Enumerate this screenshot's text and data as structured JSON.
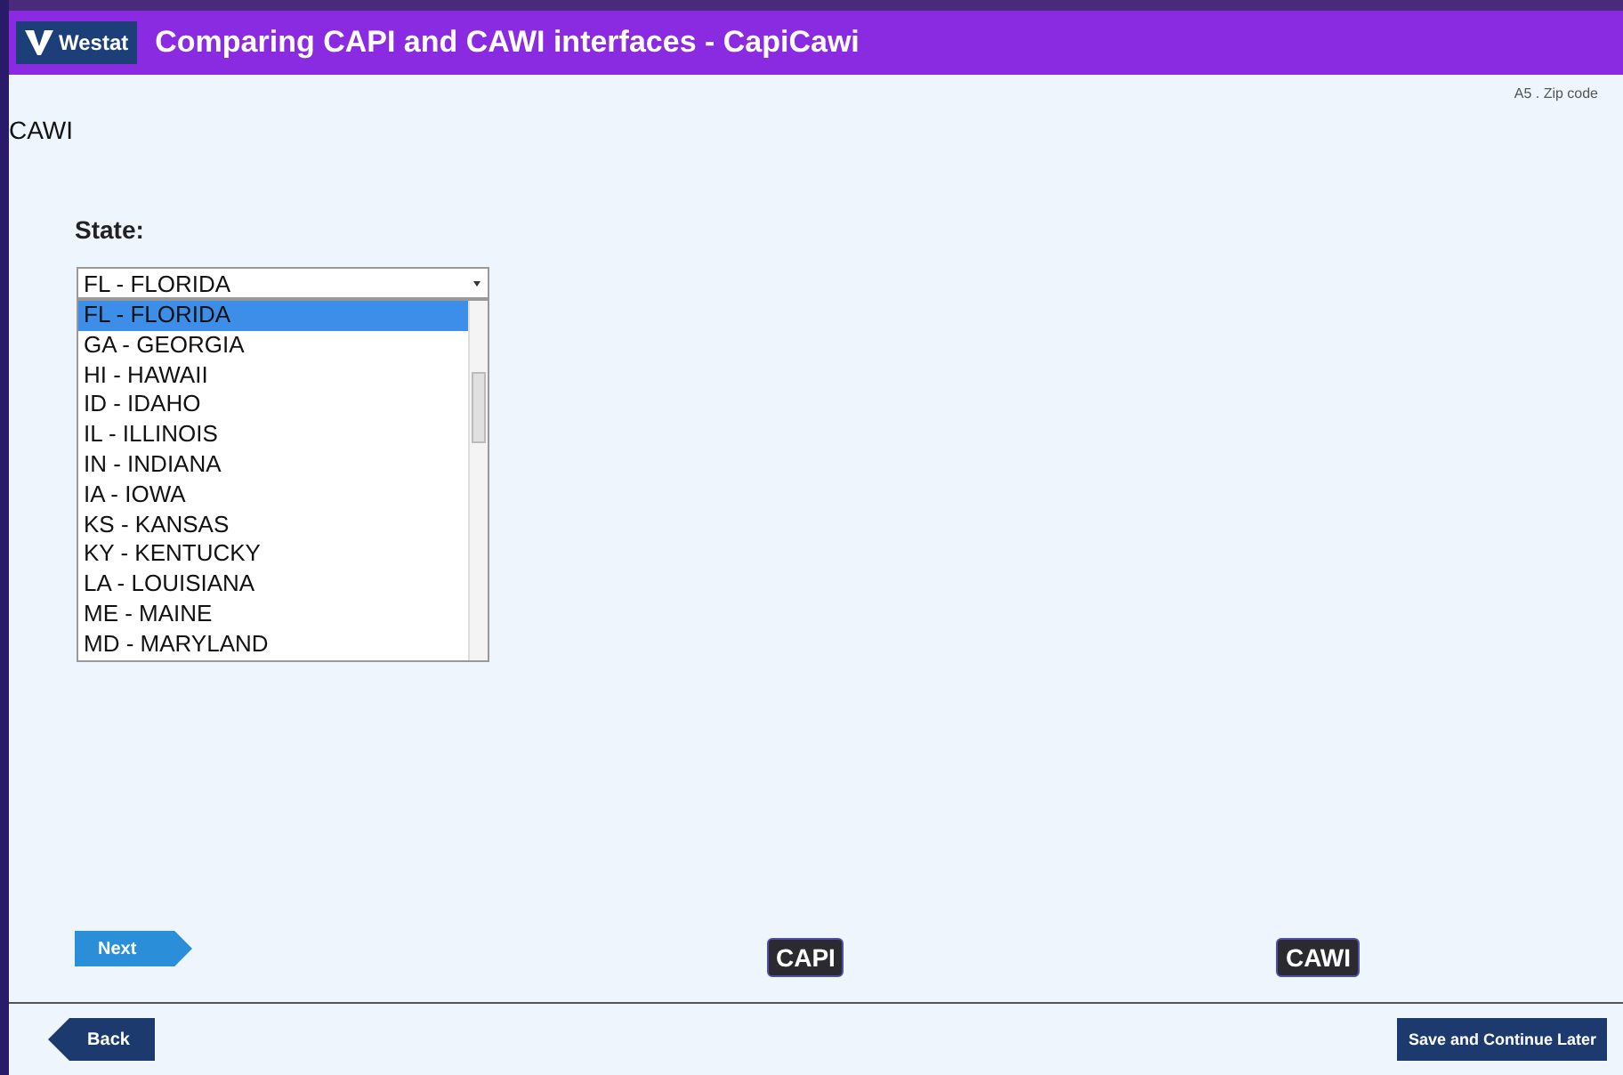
{
  "header": {
    "logo": "Westat",
    "title": "Comparing CAPI and CAWI interfaces - CapiCawi"
  },
  "question_code": "A5 . Zip code",
  "mode_label": "CAWI",
  "question": {
    "label": "State:",
    "value": "FL - FLORIDA",
    "options": [
      {
        "label": "FL - FLORIDA",
        "selected": true
      },
      {
        "label": "GA - GEORGIA",
        "selected": false
      },
      {
        "label": "HI - HAWAII",
        "selected": false
      },
      {
        "label": "ID - IDAHO",
        "selected": false
      },
      {
        "label": "IL - ILLINOIS",
        "selected": false
      },
      {
        "label": "IN - INDIANA",
        "selected": false
      },
      {
        "label": "IA - IOWA",
        "selected": false
      },
      {
        "label": "KS - KANSAS",
        "selected": false
      },
      {
        "label": "KY - KENTUCKY",
        "selected": false
      },
      {
        "label": "LA - LOUISIANA",
        "selected": false
      },
      {
        "label": "ME - MAINE",
        "selected": false
      },
      {
        "label": "MD - MARYLAND",
        "selected": false
      }
    ]
  },
  "next_button": "Next",
  "mode_buttons": [
    "CAPI",
    "CAWI"
  ],
  "back_button": "Back",
  "save_button": "Save and Continue Later"
}
